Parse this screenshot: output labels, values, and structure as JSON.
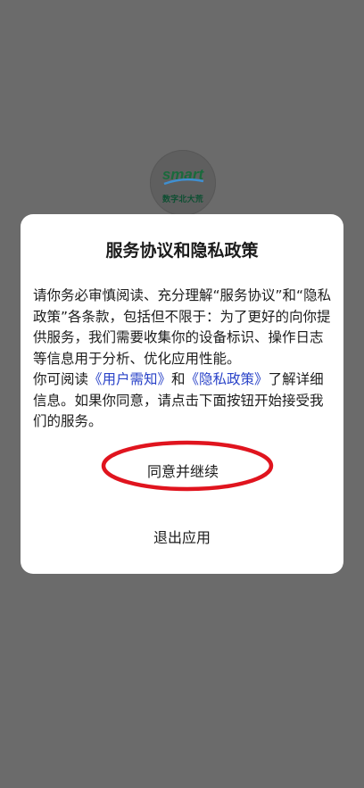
{
  "background_logo": {
    "brand_text": "smart",
    "subtitle": "数字北大荒"
  },
  "dialog": {
    "title": "服务协议和隐私政策",
    "body_part1": "请你务必审慎阅读、充分理解“服务协议”和“隐私政策”各条款，包括但不限于：为了更好的向你提供服务，我们需要收集你的设备标识、操作日志等信息用于分析、优化应用性能。",
    "body_part2_prefix": "你可阅读",
    "user_notice_link": "《用户需知》",
    "body_part2_and": "和",
    "privacy_policy_link": "《隐私政策》",
    "body_part2_suffix": "了解详细信息。如果你同意，请点击下面按钮开始接受我们的服务。",
    "agree_button": "同意并继续",
    "exit_button": "退出应用"
  },
  "colors": {
    "overlay": "#6b6b6b",
    "dialog_bg": "#ffffff",
    "link": "#2a43c8",
    "annotation_circle": "#e0141e",
    "logo_brand": "#2a8a4a"
  }
}
